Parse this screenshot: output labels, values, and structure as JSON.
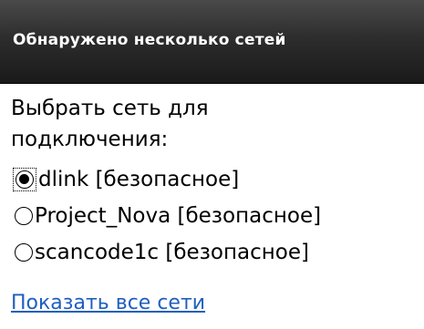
{
  "dialog": {
    "title": "Обнаружено несколько сетей",
    "prompt": "Выбрать сеть для подключения:",
    "networks": [
      {
        "label": "dlink [безопасное]",
        "selected": true
      },
      {
        "label": "Project_Nova [безопасное]",
        "selected": false
      },
      {
        "label": "scancode1c [безопасное]",
        "selected": false
      }
    ],
    "show_all_link": "Показать все сети"
  },
  "colors": {
    "title_bar": "#2d2d2d",
    "link": "#1f5fbf"
  }
}
